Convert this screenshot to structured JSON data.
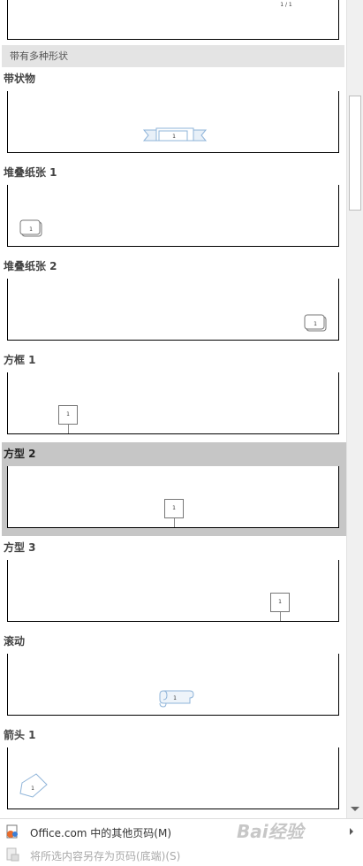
{
  "gallery": {
    "top_preview_number": "1 / 1",
    "section_header": "带有多种形状",
    "items": [
      {
        "label": "带状物",
        "number": "1",
        "shape": "ribbon"
      },
      {
        "label": "堆叠纸张 1",
        "number": "1",
        "shape": "stacked-paper"
      },
      {
        "label": "堆叠纸张 2",
        "number": "1",
        "shape": "stacked-paper"
      },
      {
        "label": "方框 1",
        "number": "1",
        "shape": "box"
      },
      {
        "label": "方型 2",
        "number": "1",
        "shape": "box",
        "selected": true
      },
      {
        "label": "方型 3",
        "number": "1",
        "shape": "box"
      },
      {
        "label": "滚动",
        "number": "1",
        "shape": "scroll"
      },
      {
        "label": "箭头 1",
        "number": "1",
        "shape": "arrow"
      }
    ]
  },
  "footer": {
    "more_from_office_label": "Office.com 中的其他页码(M)",
    "save_selection_label": "将所选内容另存为页码(底端)(S)"
  },
  "watermark": "Bai经验",
  "colors": {
    "selected_bg": "#c6c6c6",
    "section_bg": "#e4e4e4",
    "shape_accent": "#8fb4d9"
  }
}
